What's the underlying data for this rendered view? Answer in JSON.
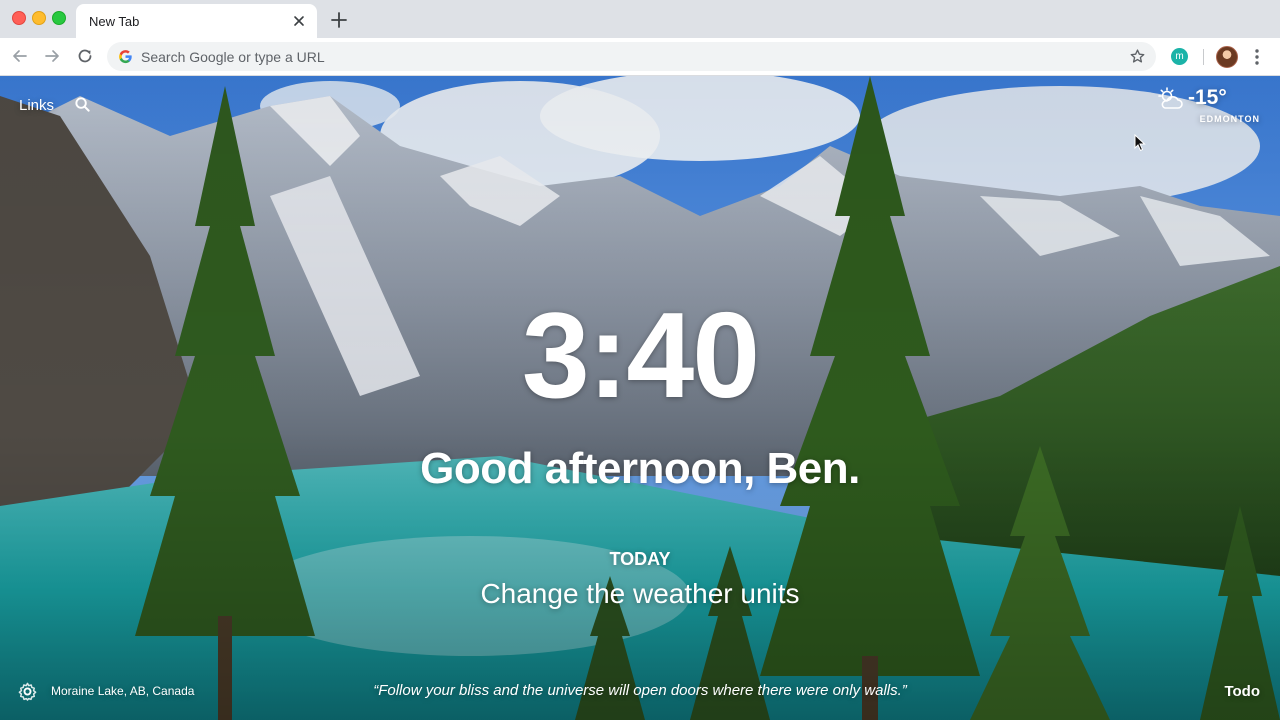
{
  "browser": {
    "tab_title": "New Tab",
    "omnibox_placeholder": "Search Google or type a URL",
    "extension_letter": "m"
  },
  "page": {
    "links_label": "Links",
    "weather": {
      "temperature": "-15°",
      "city": "EDMONTON",
      "icon": "partly-cloudy-icon"
    },
    "clock": "3:40",
    "greeting": "Good afternoon, Ben.",
    "focus": {
      "label": "TODAY",
      "task": "Change the weather units"
    },
    "photo_location": "Moraine Lake, AB, Canada",
    "quote": "“Follow your bliss and the universe will open doors where there were only walls.”",
    "todo_label": "Todo"
  },
  "colors": {
    "tabstrip_bg": "#dee1e6",
    "toolbar_bg": "#ffffff",
    "omnibox_bg": "#f1f3f4",
    "extension_accent": "#1bb3a8",
    "overlay_text": "#ffffff"
  }
}
